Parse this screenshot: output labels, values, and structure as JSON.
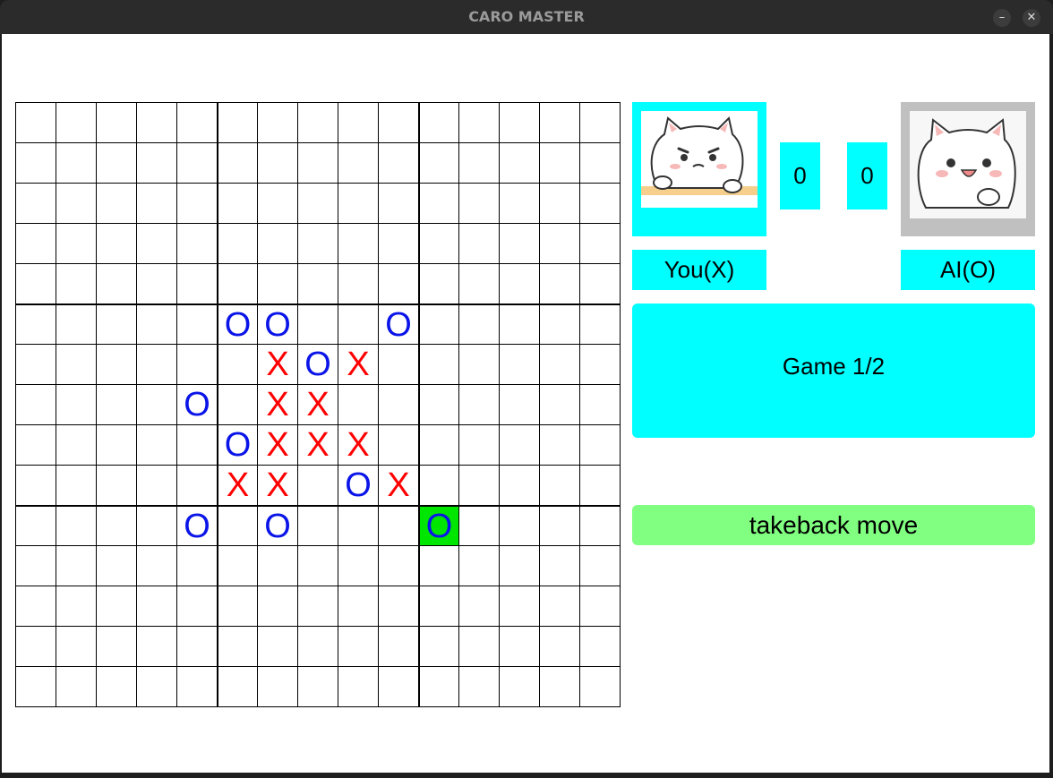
{
  "window": {
    "title": "CARO MASTER",
    "minimize_glyph": "–",
    "close_glyph": "✕"
  },
  "board": {
    "size": 15,
    "block": 5,
    "moves": [
      {
        "row": 5,
        "col": 5,
        "mark": "O"
      },
      {
        "row": 5,
        "col": 6,
        "mark": "O"
      },
      {
        "row": 5,
        "col": 9,
        "mark": "O"
      },
      {
        "row": 6,
        "col": 6,
        "mark": "X"
      },
      {
        "row": 6,
        "col": 7,
        "mark": "O"
      },
      {
        "row": 6,
        "col": 8,
        "mark": "X"
      },
      {
        "row": 7,
        "col": 4,
        "mark": "O"
      },
      {
        "row": 7,
        "col": 6,
        "mark": "X"
      },
      {
        "row": 7,
        "col": 7,
        "mark": "X"
      },
      {
        "row": 8,
        "col": 5,
        "mark": "O"
      },
      {
        "row": 8,
        "col": 6,
        "mark": "X"
      },
      {
        "row": 8,
        "col": 7,
        "mark": "X"
      },
      {
        "row": 8,
        "col": 8,
        "mark": "X"
      },
      {
        "row": 9,
        "col": 5,
        "mark": "X"
      },
      {
        "row": 9,
        "col": 6,
        "mark": "X"
      },
      {
        "row": 9,
        "col": 8,
        "mark": "O"
      },
      {
        "row": 9,
        "col": 9,
        "mark": "X"
      },
      {
        "row": 10,
        "col": 4,
        "mark": "O"
      },
      {
        "row": 10,
        "col": 6,
        "mark": "O"
      },
      {
        "row": 10,
        "col": 10,
        "mark": "O",
        "last_move": true
      }
    ],
    "x_color": "#ff0000",
    "o_color": "#0a14e8",
    "last_move_color": "#00e600"
  },
  "players": {
    "you": {
      "label": "You(X)",
      "score": "0",
      "avatar": "cat-avatar-you"
    },
    "ai": {
      "label": "AI(O)",
      "score": "0",
      "avatar": "cat-avatar-ai"
    }
  },
  "game_status": "Game 1/2",
  "takeback_label": "takeback move",
  "colors": {
    "panel": "#00ffff",
    "takeback": "#80ff80",
    "ai_frame": "#c0c0c0"
  }
}
